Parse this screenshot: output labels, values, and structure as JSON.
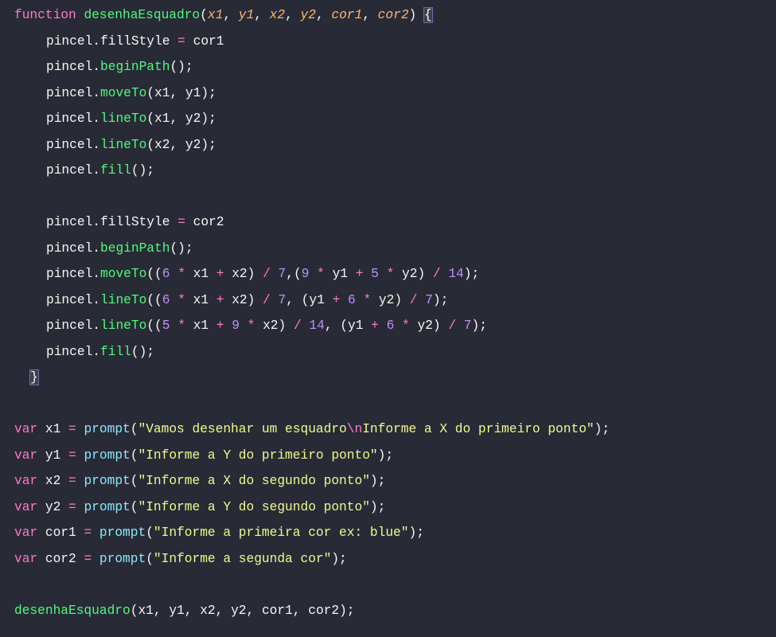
{
  "code": {
    "func_keyword": "function",
    "func_name": "desenhaEsquadro",
    "params": [
      "x1",
      "y1",
      "x2",
      "y2",
      "cor1",
      "cor2"
    ],
    "obj": "pincel",
    "prop_fillStyle": "fillStyle",
    "m_beginPath": "beginPath",
    "m_moveTo": "moveTo",
    "m_lineTo": "lineTo",
    "m_fill": "fill",
    "assign_cor1": "cor1",
    "assign_cor2": "cor2",
    "n6": "6",
    "n7": "7",
    "n9": "9",
    "n5": "5",
    "n14": "14",
    "var_keyword": "var",
    "builtin_prompt": "prompt",
    "var_x1": "x1",
    "var_y1": "y1",
    "var_x2": "x2",
    "var_y2": "y2",
    "var_cor1": "cor1",
    "var_cor2": "cor2",
    "str_prompt_x1_a": "\"Vamos desenhar um esquadro",
    "str_prompt_x1_esc": "\\n",
    "str_prompt_x1_b": "Informe a X do primeiro ponto\"",
    "str_prompt_y1": "\"Informe a Y do primeiro ponto\"",
    "str_prompt_x2": "\"Informe a X do segundo ponto\"",
    "str_prompt_y2": "\"Informe a Y do segundo ponto\"",
    "str_prompt_cor1": "\"Informe a primeira cor ex: blue\"",
    "str_prompt_cor2": "\"Informe a segunda cor\"",
    "call_func": "desenhaEsquadro"
  }
}
